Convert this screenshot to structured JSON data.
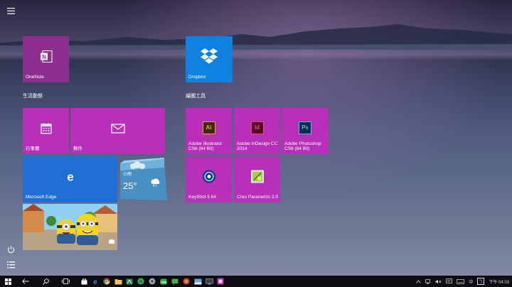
{
  "start": {
    "groups": [
      {
        "title": "生活動態"
      },
      {
        "title": "繪圖工具"
      }
    ],
    "tiles": {
      "onenote": {
        "label": "OneNote"
      },
      "dropbox": {
        "label": "Dropbox"
      },
      "calendar": {
        "label": "行事曆"
      },
      "mail": {
        "label": "郵件"
      },
      "illustrator": {
        "label": "Adobe Illustrator CS6 (64 Bit)"
      },
      "indesign": {
        "label": "Adobe InDesign CC 2014"
      },
      "photoshop": {
        "label": "Adobe Photoshop CS6 (64 Bit)"
      },
      "edge": {
        "label": "Microsoft Edge"
      },
      "weather": {
        "city": "小雨",
        "temp": "25°"
      },
      "keyshot": {
        "label": "KeyShot 5 64"
      },
      "creo": {
        "label": "Creo Parametric 2.0"
      }
    }
  },
  "taskbar": {
    "ime": "中",
    "ime_mode": "ㄅ",
    "clock": "下午 04:03"
  },
  "colors": {
    "tile": "#b82fb9",
    "edge_tile": "#1f6fd6",
    "dropbox_tile": "#1081e0",
    "taskbar": "#0e0e12"
  }
}
